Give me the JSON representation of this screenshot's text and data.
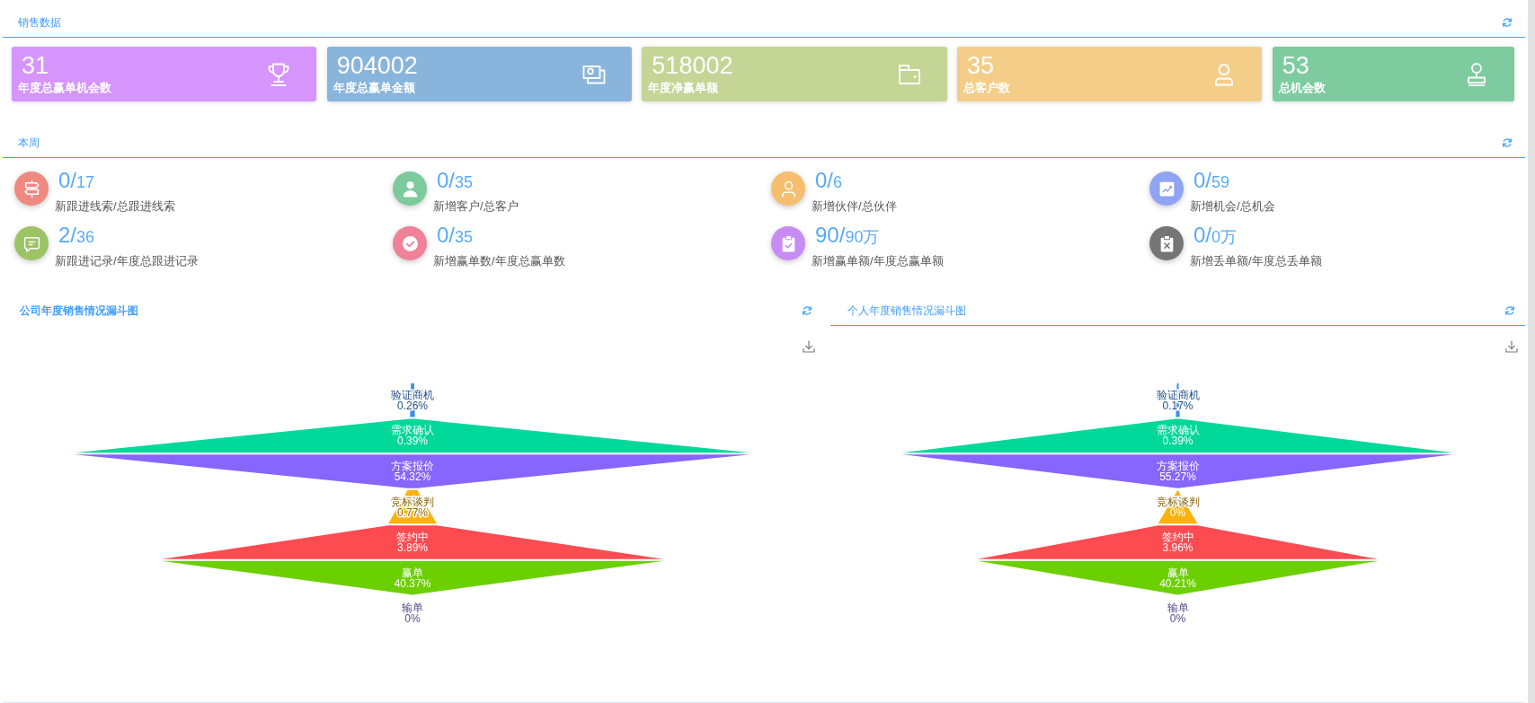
{
  "sales_data": {
    "title": "销售数据",
    "cards": [
      {
        "value": "31",
        "label": "年度总赢单机会数",
        "color": "#d595fc"
      },
      {
        "value": "904002",
        "label": "年度总赢单金额",
        "color": "#89b5dd"
      },
      {
        "value": "518002",
        "label": "年度净赢单额",
        "color": "#c4d596"
      },
      {
        "value": "35",
        "label": "总客户数",
        "color": "#f4ce89"
      },
      {
        "value": "53",
        "label": "总机会数",
        "color": "#7dcb9e"
      }
    ]
  },
  "this_week": {
    "title": "本周",
    "items": [
      {
        "current": "0/",
        "total": "17",
        "label": "新跟进线索/总跟进线索",
        "color": "#f08982"
      },
      {
        "current": "0/",
        "total": "35",
        "label": "新增客户/总客户",
        "color": "#7dca9d"
      },
      {
        "current": "0/",
        "total": "6",
        "label": "新增伙伴/总伙伴",
        "color": "#f5bf6f"
      },
      {
        "current": "0/",
        "total": "59",
        "label": "新增机会/总机会",
        "color": "#8fa5f4"
      },
      {
        "current": "2/",
        "total": "36",
        "label": "新跟进记录/年度总跟进记录",
        "color": "#9cc465"
      },
      {
        "current": "0/",
        "total": "35",
        "label": "新增赢单数/年度总赢单数",
        "color": "#ef8297"
      },
      {
        "current": "90/",
        "total": "90万",
        "label": "新增赢单额/年度总赢单额",
        "color": "#c78cf3"
      },
      {
        "current": "0/",
        "total": "0万",
        "label": "新增丢单额/年度总丢单额",
        "color": "#757575"
      }
    ]
  },
  "funnels": [
    {
      "title": "公司年度销售情况漏斗图",
      "chart_data": {
        "type": "other",
        "categories": [
          "验证商机",
          "需求确认",
          "方案报价",
          "竞标谈判",
          "签约中",
          "赢单",
          "输单"
        ],
        "values": [
          0.26,
          0.39,
          54.32,
          0.77,
          3.89,
          40.37,
          0
        ],
        "colors": [
          "#3a8ef6",
          "#00d89a",
          "#8666fc",
          "#fbb30a",
          "#fd4b52",
          "#6ccf00",
          "#8c89ff"
        ],
        "value_labels": [
          "0.26%",
          "0.39%",
          "54.32%",
          "0.77%",
          "3.89%",
          "40.37%",
          "0%"
        ]
      }
    },
    {
      "title": "个人年度销售情况漏斗图",
      "chart_data": {
        "type": "other",
        "categories": [
          "验证商机",
          "需求确认",
          "方案报价",
          "竞标谈判",
          "签约中",
          "赢单",
          "输单"
        ],
        "values": [
          0.17,
          0.39,
          55.27,
          0,
          3.96,
          40.21,
          0
        ],
        "colors": [
          "#3a8ef6",
          "#00d89a",
          "#8666fc",
          "#fbb30a",
          "#fd4b52",
          "#6ccf00",
          "#8c89ff"
        ],
        "value_labels": [
          "0.17%",
          "0.39%",
          "55.27%",
          "0%",
          "3.96%",
          "40.21%",
          "0%"
        ]
      }
    }
  ]
}
